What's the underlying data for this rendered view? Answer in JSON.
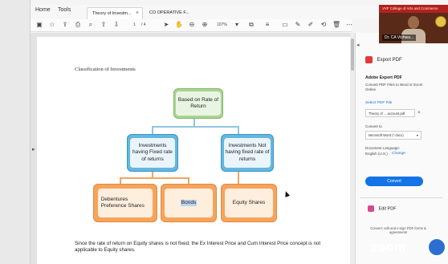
{
  "menu": {
    "home": "Home",
    "tools": "Tools"
  },
  "tabs": [
    {
      "label": "Theory of Investm...",
      "close": "×"
    },
    {
      "label": "CO OPERATIVE F..."
    }
  ],
  "toolbar": {
    "page_current": "1",
    "page_total": "/ 4",
    "zoom": "107%"
  },
  "document": {
    "heading": "Classification of Investments",
    "chart": {
      "root": "Based on Rate of Return",
      "branch_left": "Investments having Fixed rate of returns",
      "branch_right": "Investments Not having fixed rate of returns",
      "leaf_1": "Debentures Preference Shares",
      "leaf_2": "Bonds",
      "leaf_3": "Equity Shares"
    },
    "paragraph": "Since the rate of return on Equity shares is not fixed, the Ex Interest Price and Cum Interest Price concept is not applicable to Equity shares."
  },
  "right_panel": {
    "export_label": "Export PDF",
    "title": "Adobe Export PDF",
    "description": "Convert PDF Files to Word or Excel Online",
    "select_file_link": "Select PDF File",
    "file_name": "Theory of ....account.pdf",
    "convert_to_label": "Convert to",
    "convert_to_value": "Microsoft Word (*.docx)",
    "doc_language_label": "Document Language:",
    "doc_language_value": "English (U.S.)",
    "change_link": "Change",
    "convert_button": "Convert",
    "edit_label": "Edit PDF",
    "footer": "Convert, edit and e-sign PDF forms & agreements"
  },
  "webcam": {
    "banner": "VVF College of Arts and Commerce",
    "name": "Dr. CA Vishwa..."
  },
  "watermark": "zoom",
  "colors": {
    "green": "#a9d694",
    "blue": "#64b7e0",
    "orange": "#f6a45d",
    "accent": "#1473e6"
  }
}
